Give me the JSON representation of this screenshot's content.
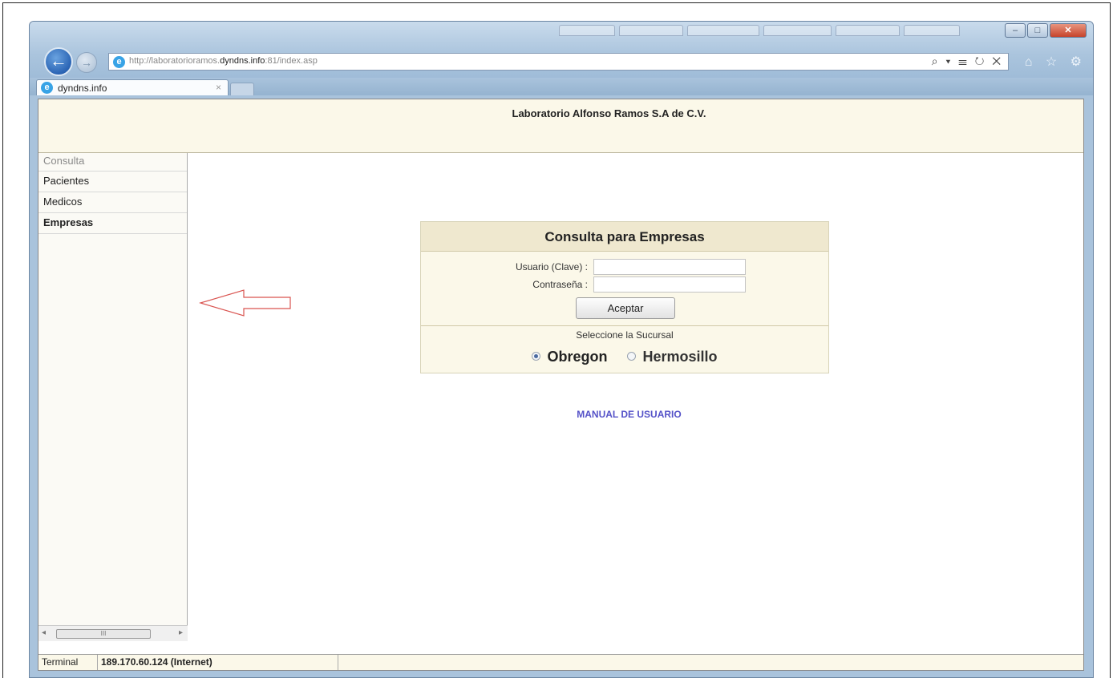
{
  "browser": {
    "url_prefix": "http://laboratorioramos.",
    "url_domain": "dyndns.info",
    "url_suffix": ":81/index.asp",
    "tab_title": "dyndns.info",
    "tab_close": "×",
    "address_tools": "⌕ ▾ ☰ ↻ ✕",
    "right_icons": "⌂ ☆ ⚙",
    "window_controls": {
      "minimize": "–",
      "maximize": "□",
      "close": "✕"
    }
  },
  "header": {
    "title": "Laboratorio Alfonso Ramos S.A de C.V."
  },
  "sidebar": {
    "items": [
      {
        "label": "Consulta"
      },
      {
        "label": "Pacientes"
      },
      {
        "label": "Medicos"
      },
      {
        "label": "Empresas"
      }
    ],
    "scroll_thumb": "III"
  },
  "panel": {
    "title": "Consulta para Empresas",
    "user_label": "Usuario (Clave) :",
    "user_value": "",
    "password_label": "Contraseña :",
    "password_value": "",
    "accept_button": "Aceptar",
    "branch_prompt": "Seleccione la Sucursal",
    "branches": [
      {
        "label": "Obregon",
        "selected": true
      },
      {
        "label": "Hermosillo",
        "selected": false
      }
    ]
  },
  "manual_link": "MANUAL DE USUARIO",
  "status": {
    "terminal_label": "Terminal",
    "ip": "189.170.60.124 (Internet)"
  },
  "colors": {
    "header_bg": "#fbf8e9",
    "panel_head_bg": "#efe8cf",
    "link": "#5552c8",
    "annotation_arrow": "#d9534f"
  }
}
